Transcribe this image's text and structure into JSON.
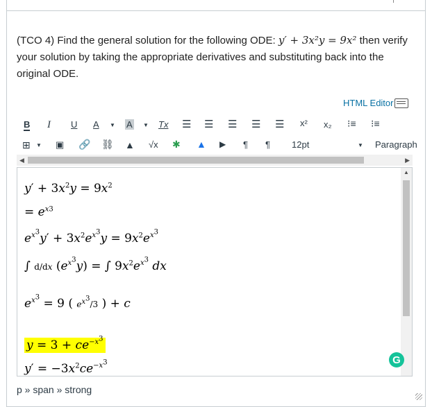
{
  "question": {
    "prefix": "(TCO 4) Find the general solution for the following ODE: ",
    "equation": "y′ + 3x²y = 9x²",
    "suffix": " then verify your solution by taking the appropriate derivatives and substituting back into the original ODE."
  },
  "editor_link": "HTML Editor",
  "toolbar": {
    "bold": "B",
    "italic": "I",
    "underline": "U",
    "font_color": "A",
    "bg_color": "A",
    "clear_format": "Tx",
    "superscript": "x²",
    "subscript": "x₂",
    "font_size": "12pt",
    "paragraph": "Paragraph"
  },
  "content": {
    "line1": "y′ + 3x²y = 9x²",
    "line2": "= e^{x3}",
    "line3": "e^{x³}y′ + 3x²e^{x³}y = 9x²e^{x³}",
    "line4": "∫ d/dx (e^{x³}y) = ∫ 9x²e^{x³} dx",
    "line5": "e^{x³} = 9 (e^{x³}/3) + c",
    "line6": "y = 3 + ce^{−x³}",
    "line7": "y′ = −3x²ce^{−x³}"
  },
  "status_path": "p » span » strong",
  "grammarly_letter": "G",
  "colors": {
    "link": "#0770a3",
    "highlight": "#ffff00",
    "grammarly": "#15c39a"
  }
}
